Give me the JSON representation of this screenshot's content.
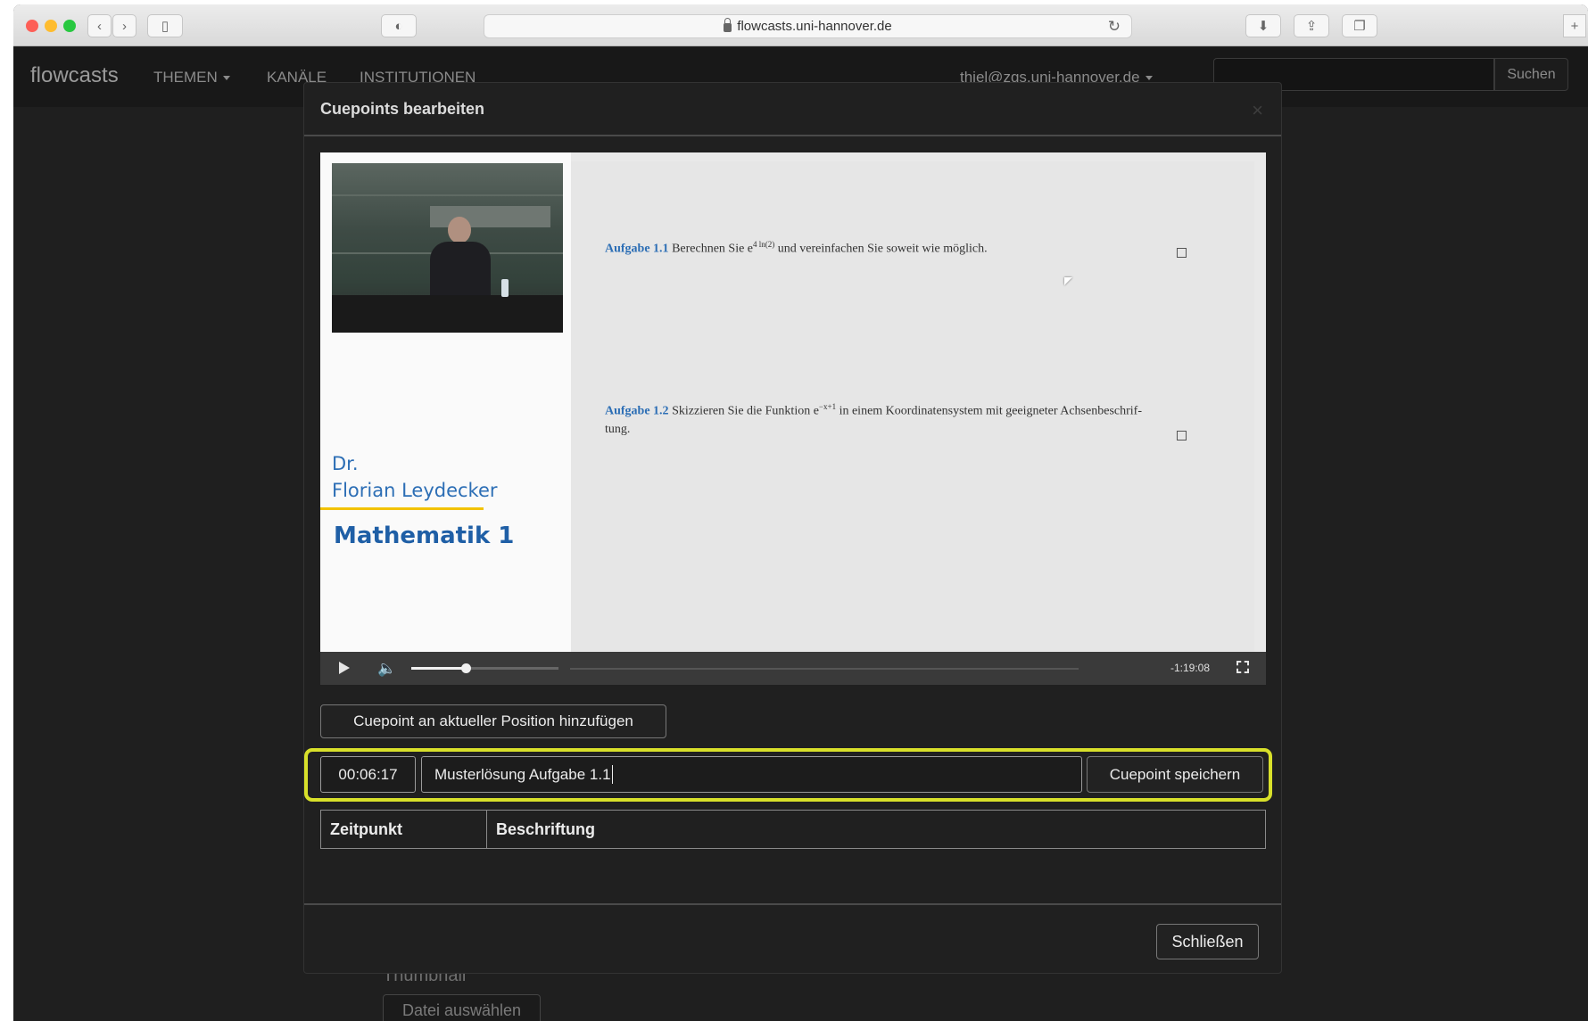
{
  "browser": {
    "url": "flowcasts.uni-hannover.de",
    "colors": {
      "close": "#fd5f57",
      "minimize": "#febc2e",
      "zoom": "#28c840"
    }
  },
  "navbar": {
    "brand": "flowcasts",
    "items": [
      {
        "label": "THEMEN",
        "dropdown": true
      },
      {
        "label": "KANÄLE",
        "dropdown": false
      },
      {
        "label": "INSTITUTIONEN",
        "dropdown": false
      }
    ],
    "user": "thiel@zqs.uni-hannover.de",
    "search_button": "Suchen"
  },
  "background_page": {
    "thumbnail_label": "Thumbnail",
    "file_button": "Datei auswählen"
  },
  "modal": {
    "title": "Cuepoints bearbeiten",
    "close_symbol": "×",
    "video": {
      "speaker_title": "Dr.",
      "speaker_name": "Florian Leydecker",
      "course": "Mathematik 1",
      "task1": {
        "label": "Aufgabe 1.1",
        "text": "Berechnen Sie e",
        "sup": "4 ln(2)",
        "rest": "und vereinfachen Sie soweit wie möglich."
      },
      "task2": {
        "label": "Aufgabe 1.2",
        "text": "Skizzieren Sie die Funktion e",
        "sup": "−x+1",
        "rest": "in einem Koordinatensystem mit geeigneter Achsenbeschrif-",
        "line2": "tung."
      },
      "remaining_time": "-1:19:08",
      "volume_level": 0.37
    },
    "add_cuepoint_button": "Cuepoint an aktueller Position hinzufügen",
    "cuepoint_time": "00:06:17",
    "cuepoint_label": "Musterlösung Aufgabe 1.1",
    "save_cuepoint_button": "Cuepoint speichern",
    "table_headers": [
      "Zeitpunkt",
      "Beschriftung"
    ],
    "close_button": "Schließen",
    "highlight_color": "#d8e02a"
  }
}
